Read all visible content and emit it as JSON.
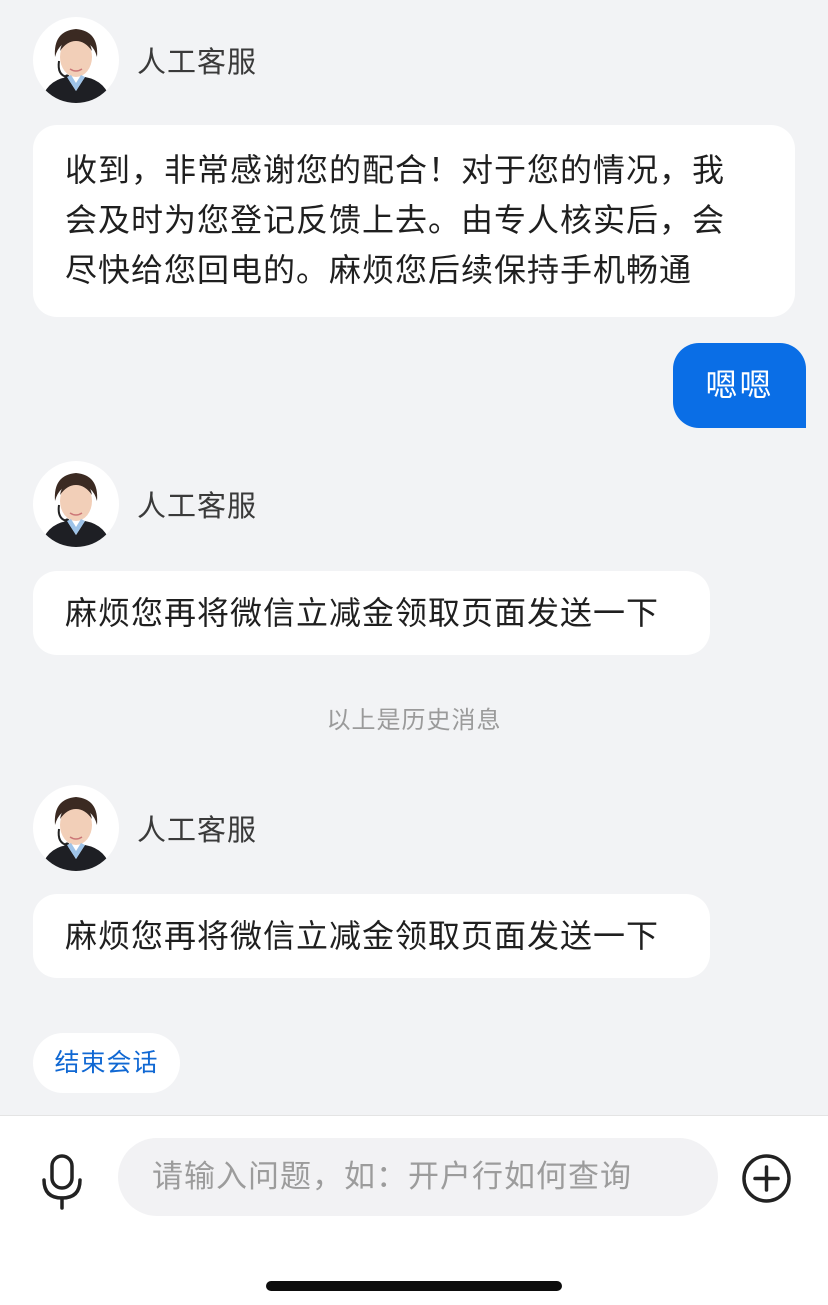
{
  "messages": [
    {
      "sender": "人工客服",
      "lines": [
        "收到，非常感谢您的配合！对于您的情况，我",
        "会及时为您登记反馈上去。由专人核实后，会",
        "尽快给您回电的。麻烦您后续保持手机畅通"
      ]
    },
    {
      "sender": "我",
      "text": "嗯嗯"
    },
    {
      "sender": "人工客服",
      "text": "麻烦您再将微信立减金领取页面发送一下"
    },
    {
      "sender": "人工客服",
      "text": "麻烦您再将微信立减金领取页面发送一下"
    }
  ],
  "history_divider": "以上是历史消息",
  "end_session_label": "结束会话",
  "input": {
    "placeholder": "请输入问题，如：开户行如何查询",
    "value": ""
  },
  "icons": {
    "mic": "microphone-icon",
    "plus": "plus-circle-icon",
    "avatar": "customer-service-avatar"
  },
  "colors": {
    "accent": "#0a6ee6",
    "link": "#1068d3",
    "background": "#f2f3f5"
  }
}
